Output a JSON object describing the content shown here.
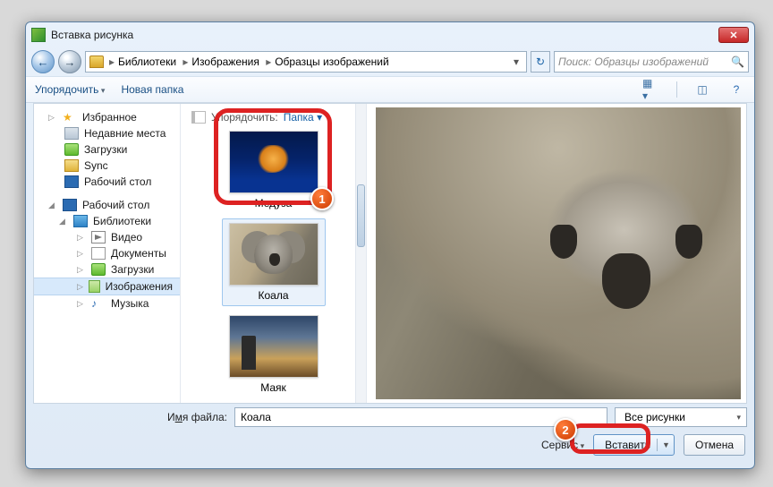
{
  "window": {
    "title": "Вставка рисунка"
  },
  "breadcrumb": {
    "root_icon": "folder",
    "items": [
      "Библиотеки",
      "Изображения",
      "Образцы изображений"
    ]
  },
  "search": {
    "placeholder": "Поиск: Образцы изображений"
  },
  "toolbar": {
    "organize": "Упорядочить",
    "newfolder": "Новая папка"
  },
  "arrange": {
    "label": "Упорядочить:",
    "value": "Папка"
  },
  "sidebar": {
    "fav_header": "Избранное",
    "fav": [
      {
        "label": "Недавние места",
        "icon": "recent"
      },
      {
        "label": "Загрузки",
        "icon": "down"
      },
      {
        "label": "Sync",
        "icon": "sync"
      },
      {
        "label": "Рабочий стол",
        "icon": "mon"
      }
    ],
    "desk_header": "Рабочий стол",
    "lib_header": "Библиотеки",
    "libs": [
      {
        "label": "Видео",
        "icon": "vid"
      },
      {
        "label": "Документы",
        "icon": "doc"
      },
      {
        "label": "Загрузки",
        "icon": "down"
      },
      {
        "label": "Изображения",
        "icon": "img",
        "selected": true
      },
      {
        "label": "Музыка",
        "icon": "mus"
      }
    ]
  },
  "thumbs": [
    {
      "label": "Медуза",
      "kind": "jelly"
    },
    {
      "label": "Коала",
      "kind": "koala",
      "selected": true
    },
    {
      "label": "Маяк",
      "kind": "light"
    }
  ],
  "footer": {
    "filename_label_pre": "И",
    "filename_label_ul": "м",
    "filename_label_post": "я файла:",
    "filename_value": "Коала",
    "filetype": "Все рисунки",
    "tools": "Сервис",
    "insert": "Вставить",
    "cancel": "Отмена"
  },
  "annotations": {
    "step1": "1",
    "step2": "2"
  }
}
